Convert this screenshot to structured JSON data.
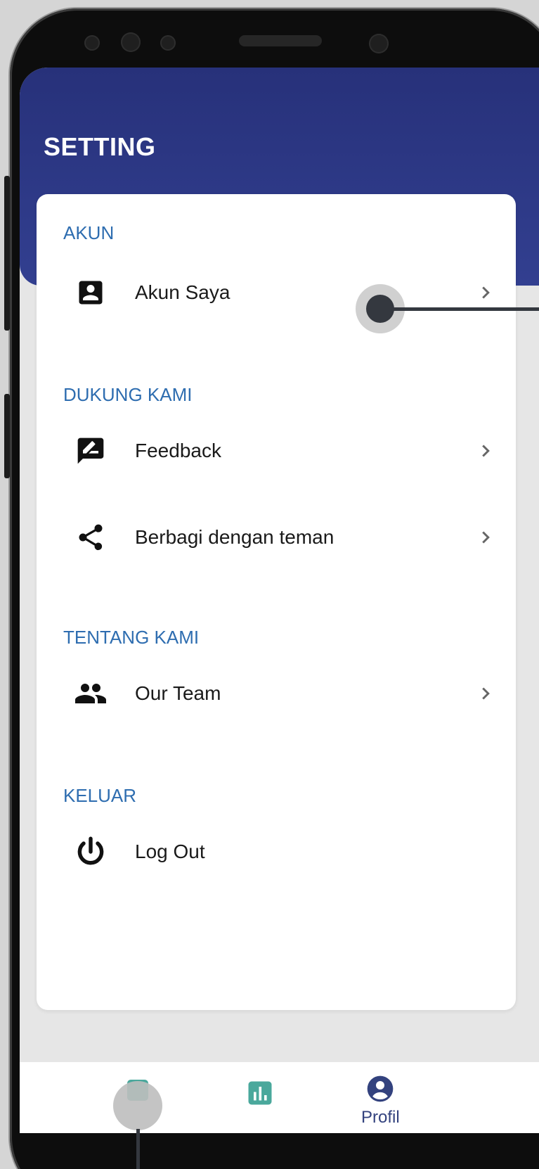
{
  "header": {
    "title": "SETTING"
  },
  "sections": [
    {
      "label": "AKUN",
      "items": [
        {
          "label": "Akun Saya",
          "icon": "account-box-icon",
          "chevron": true
        }
      ]
    },
    {
      "label": "DUKUNG KAMI",
      "items": [
        {
          "label": "Feedback",
          "icon": "feedback-icon",
          "chevron": true
        },
        {
          "label": "Berbagi dengan teman",
          "icon": "share-icon",
          "chevron": true
        }
      ]
    },
    {
      "label": "TENTANG KAMI",
      "items": [
        {
          "label": "Our Team",
          "icon": "group-icon",
          "chevron": true
        }
      ]
    },
    {
      "label": "KELUAR",
      "items": [
        {
          "label": "Log Out",
          "icon": "power-icon",
          "chevron": false
        }
      ]
    }
  ],
  "bottom_nav": {
    "items": [
      {
        "icon": "home-icon",
        "label": ""
      },
      {
        "icon": "chart-icon",
        "label": ""
      },
      {
        "icon": "profile-icon",
        "label": "Profil"
      }
    ]
  },
  "colors": {
    "header": "#27317a",
    "section_label": "#2e6db0",
    "nav_active": "#33427e",
    "nav_teal": "#4aa89c"
  }
}
